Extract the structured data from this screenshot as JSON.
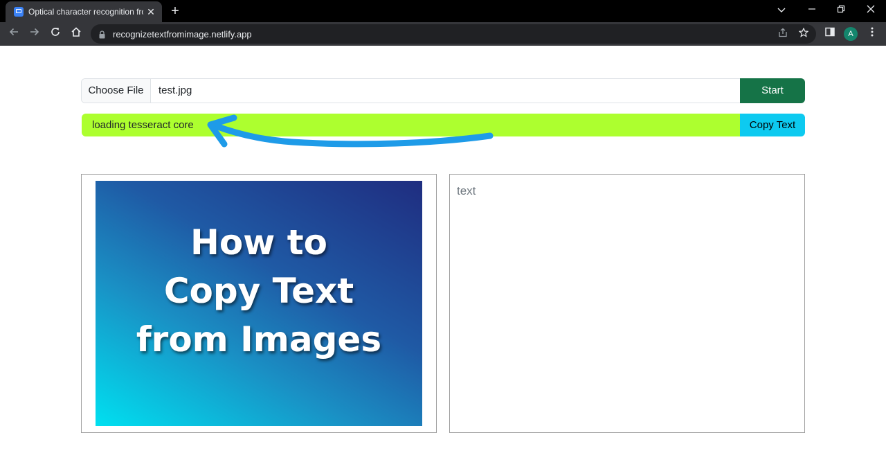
{
  "browser": {
    "tab_title": "Optical character recognition from Image",
    "close_glyph": "✕",
    "new_tab_glyph": "+",
    "url": "recognizetextfromimage.netlify.app",
    "profile_initial": "A"
  },
  "upload": {
    "choose_label": "Choose File",
    "file_name": "test.jpg",
    "start_label": "Start"
  },
  "status": {
    "message": "loading tesseract core",
    "copy_label": "Copy Text",
    "bar_color": "#adff2f"
  },
  "preview": {
    "image_lines": [
      "How to",
      "Copy Text",
      "from Images"
    ]
  },
  "output": {
    "placeholder": "text"
  },
  "colors": {
    "start_button": "#157347",
    "copy_button": "#0dcaf0",
    "annotation_arrow": "#1e9be8"
  }
}
